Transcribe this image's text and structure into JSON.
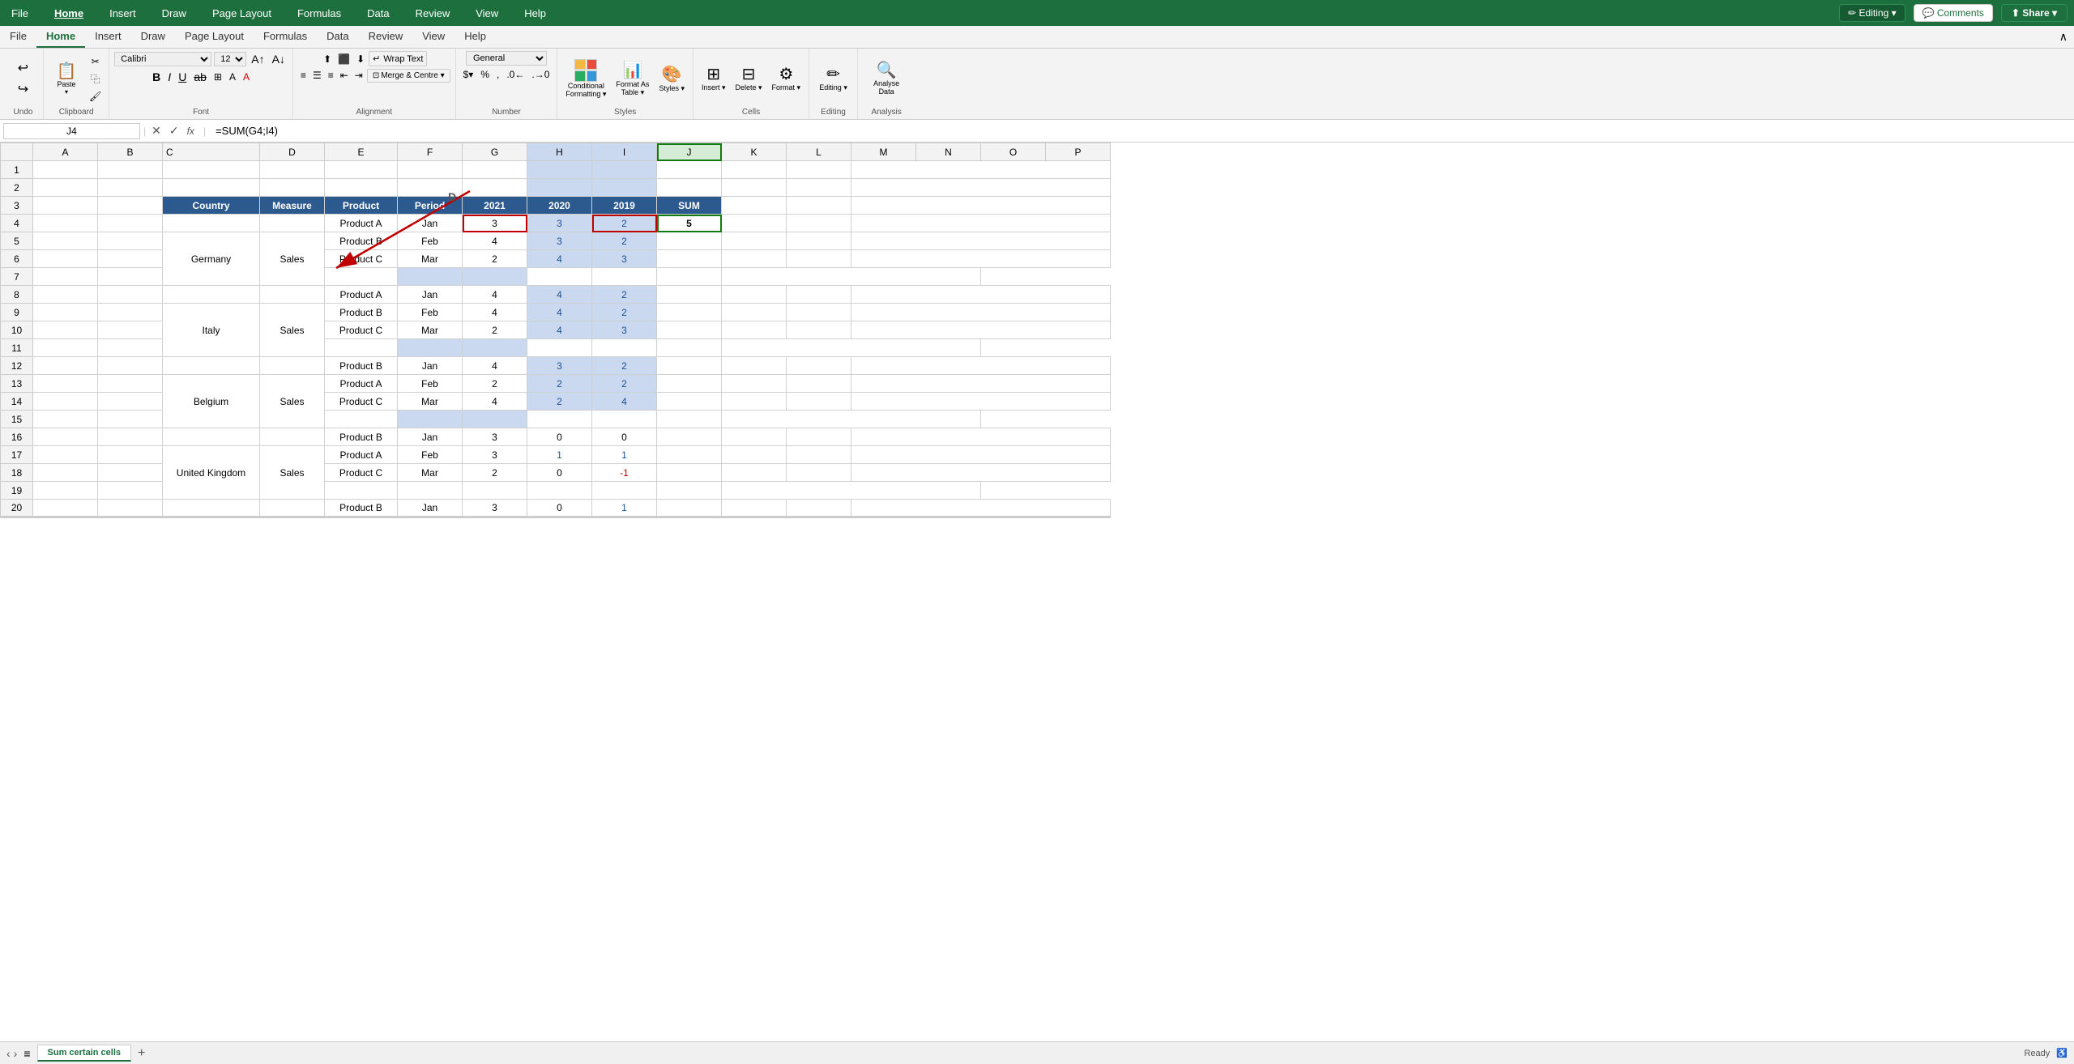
{
  "titlebar": {
    "tabs": [
      "File",
      "Home",
      "Insert",
      "Draw",
      "Page Layout",
      "Formulas",
      "Data",
      "Review",
      "View",
      "Help"
    ],
    "active_tab": "Home",
    "editing_btn": "✏ Editing ▾",
    "comments_btn": "💬 Comments",
    "share_btn": "⬆ Share ▾"
  },
  "ribbon": {
    "groups": {
      "undo": {
        "label": "",
        "undo": "↩",
        "redo": "↪"
      },
      "clipboard": {
        "label": "Clipboard",
        "paste": "📋",
        "cut": "✂",
        "copy": "⿻",
        "painter": "🖌"
      },
      "font": {
        "label": "Font",
        "font_name": "Calibri",
        "font_size": "12",
        "bold": "B",
        "italic": "I",
        "underline": "U"
      },
      "alignment": {
        "label": "Alignment",
        "wrap_text": "Wrap Text",
        "merge": "Merge & Centre ▾"
      },
      "number": {
        "label": "Number",
        "format": "General"
      },
      "styles": {
        "label": "Styles",
        "conditional": "Conditional\nFormatting ▾",
        "format_table": "Format As\nTable ▾",
        "styles": "Styles ▾"
      },
      "cells": {
        "label": "Cells",
        "insert": "Insert ▾",
        "delete": "Delete ▾",
        "format": "Format ▾"
      },
      "editing": {
        "label": "Editing",
        "label_text": "Editing ▾"
      },
      "analysis": {
        "label": "Analysis",
        "analyse": "Analyse\nData"
      }
    }
  },
  "formula_bar": {
    "cell_ref": "J4",
    "formula": "=SUM(G4;I4)"
  },
  "sheet": {
    "columns": [
      "",
      "A",
      "B",
      "C",
      "D",
      "E",
      "F",
      "G",
      "H",
      "I",
      "J",
      "K",
      "L",
      "M",
      "N",
      "O",
      "P"
    ],
    "col_labels": {
      "C": "Country",
      "D": "Measure",
      "E": "Product",
      "F": "Period",
      "G": "2021",
      "H": "2020",
      "I": "2019",
      "J": "SUM"
    },
    "rows": [
      {
        "row": 1,
        "cells": {}
      },
      {
        "row": 2,
        "cells": {}
      },
      {
        "row": 3,
        "cells": {
          "C": "Country",
          "D": "Measure",
          "E": "Product",
          "F": "Period",
          "G": "2021",
          "H": "2020",
          "I": "2019",
          "J": "SUM"
        },
        "isHeader": true
      },
      {
        "row": 4,
        "cells": {
          "E": "Product A",
          "F": "Jan",
          "G": "3",
          "H": "3",
          "I": "2",
          "J": "5"
        },
        "redOutline": [
          "G",
          "I",
          "J"
        ],
        "highlighted": [
          "H",
          "I"
        ]
      },
      {
        "row": 5,
        "cells": {
          "C": "Germany",
          "D": "Sales",
          "E": "Product B",
          "F": "Feb",
          "G": "4",
          "H": "3",
          "I": "2"
        },
        "highlighted": [
          "H",
          "I"
        ]
      },
      {
        "row": 6,
        "cells": {
          "E": "Product C",
          "F": "Mar",
          "G": "2",
          "H": "4",
          "I": "3"
        },
        "highlighted": [
          "H",
          "I"
        ]
      },
      {
        "row": 7,
        "cells": {}
      },
      {
        "row": 8,
        "cells": {
          "E": "Product A",
          "F": "Jan",
          "G": "4",
          "H": "4",
          "I": "2"
        },
        "highlighted": [
          "H",
          "I"
        ]
      },
      {
        "row": 9,
        "cells": {
          "C": "Italy",
          "D": "Sales",
          "E": "Product B",
          "F": "Feb",
          "G": "4",
          "H": "4",
          "I": "2"
        },
        "highlighted": [
          "H",
          "I"
        ]
      },
      {
        "row": 10,
        "cells": {
          "E": "Product C",
          "F": "Mar",
          "G": "2",
          "H": "4",
          "I": "3"
        },
        "highlighted": [
          "H",
          "I"
        ]
      },
      {
        "row": 11,
        "cells": {}
      },
      {
        "row": 12,
        "cells": {
          "E": "Product B",
          "F": "Jan",
          "G": "4",
          "H": "3",
          "I": "2"
        },
        "highlighted": [
          "H",
          "I"
        ]
      },
      {
        "row": 13,
        "cells": {
          "C": "Belgium",
          "D": "Sales",
          "E": "Product A",
          "F": "Feb",
          "G": "2",
          "H": "2",
          "I": "2"
        },
        "highlighted": [
          "H",
          "I"
        ]
      },
      {
        "row": 14,
        "cells": {
          "E": "Product C",
          "F": "Mar",
          "G": "4",
          "H": "2",
          "I": "4"
        },
        "highlighted": [
          "H",
          "I"
        ]
      },
      {
        "row": 15,
        "cells": {}
      },
      {
        "row": 16,
        "cells": {
          "E": "Product B",
          "F": "Jan",
          "G": "3",
          "H": "0",
          "I": "0"
        }
      },
      {
        "row": 17,
        "cells": {
          "C": "United Kingdom",
          "D": "Sales",
          "E": "Product A",
          "F": "Feb",
          "G": "3",
          "H": "1",
          "I": "1"
        },
        "blueH": [
          "H",
          "I"
        ]
      },
      {
        "row": 18,
        "cells": {
          "E": "Product C",
          "F": "Mar",
          "G": "2",
          "H": "0",
          "I": "-1"
        },
        "redI": true
      },
      {
        "row": 19,
        "cells": {}
      },
      {
        "row": 20,
        "cells": {
          "E": "Product B",
          "F": "Jan",
          "G": "3",
          "H": "0",
          "I": "1"
        },
        "blueI20": true
      }
    ]
  },
  "status_bar": {
    "tab_label": "Sum certain cells",
    "add_btn": "+",
    "nav_prev": "‹",
    "nav_next": "›",
    "menu_icon": "≡"
  },
  "annotations": {
    "arrow_label": "D",
    "sum_label": "Sum certain cells"
  }
}
